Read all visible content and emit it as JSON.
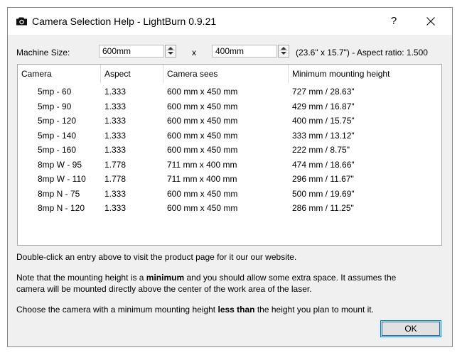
{
  "window": {
    "title": "Camera Selection Help - LightBurn 0.9.21",
    "help_label": "?",
    "icons": {
      "title": "camera-icon",
      "close": "close-icon"
    }
  },
  "machine": {
    "label": "Machine Size:",
    "width_value": "600mm",
    "separator": "x",
    "height_value": "400mm",
    "summary": "(23.6\" x 15.7\") - Aspect ratio: 1.500"
  },
  "table": {
    "headers": [
      "Camera",
      "Aspect",
      "Camera sees",
      "Minimum mounting height"
    ],
    "rows": [
      [
        "5mp - 60",
        "1.333",
        "600 mm x 450 mm",
        "727 mm / 28.63\""
      ],
      [
        "5mp - 90",
        "1.333",
        "600 mm x 450 mm",
        "429 mm / 16.87\""
      ],
      [
        "5mp - 120",
        "1.333",
        "600 mm x 450 mm",
        "400 mm / 15.75\""
      ],
      [
        "5mp - 140",
        "1.333",
        "600 mm x 450 mm",
        "333 mm / 13.12\""
      ],
      [
        "5mp - 160",
        "1.333",
        "600 mm x 450 mm",
        "222 mm / 8.75\""
      ],
      [
        "8mp W - 95",
        "1.778",
        "711 mm x 400 mm",
        "474 mm / 18.66\""
      ],
      [
        "8mp W - 110",
        "1.778",
        "711 mm x 400 mm",
        "296 mm / 11.67\""
      ],
      [
        "8mp N - 75",
        "1.333",
        "600 mm x 450 mm",
        "500 mm / 19.69\""
      ],
      [
        "8mp N - 120",
        "1.333",
        "600 mm x 450 mm",
        "286 mm / 11.25\""
      ]
    ]
  },
  "notes": {
    "double_click": "Double-click an entry above to visit the product page for it our our website.",
    "mount_a": "Note that the mounting height is a ",
    "mount_bold": "minimum",
    "mount_b": " and you should allow some extra space. It assumes the",
    "mount_line2": "camera will be mounted directly above the center of the work area of the laser.",
    "choose_a": "Choose the camera with a minimum mounting height ",
    "choose_bold": "less than",
    "choose_b": " the height you plan to mount it."
  },
  "buttons": {
    "ok": "OK"
  }
}
